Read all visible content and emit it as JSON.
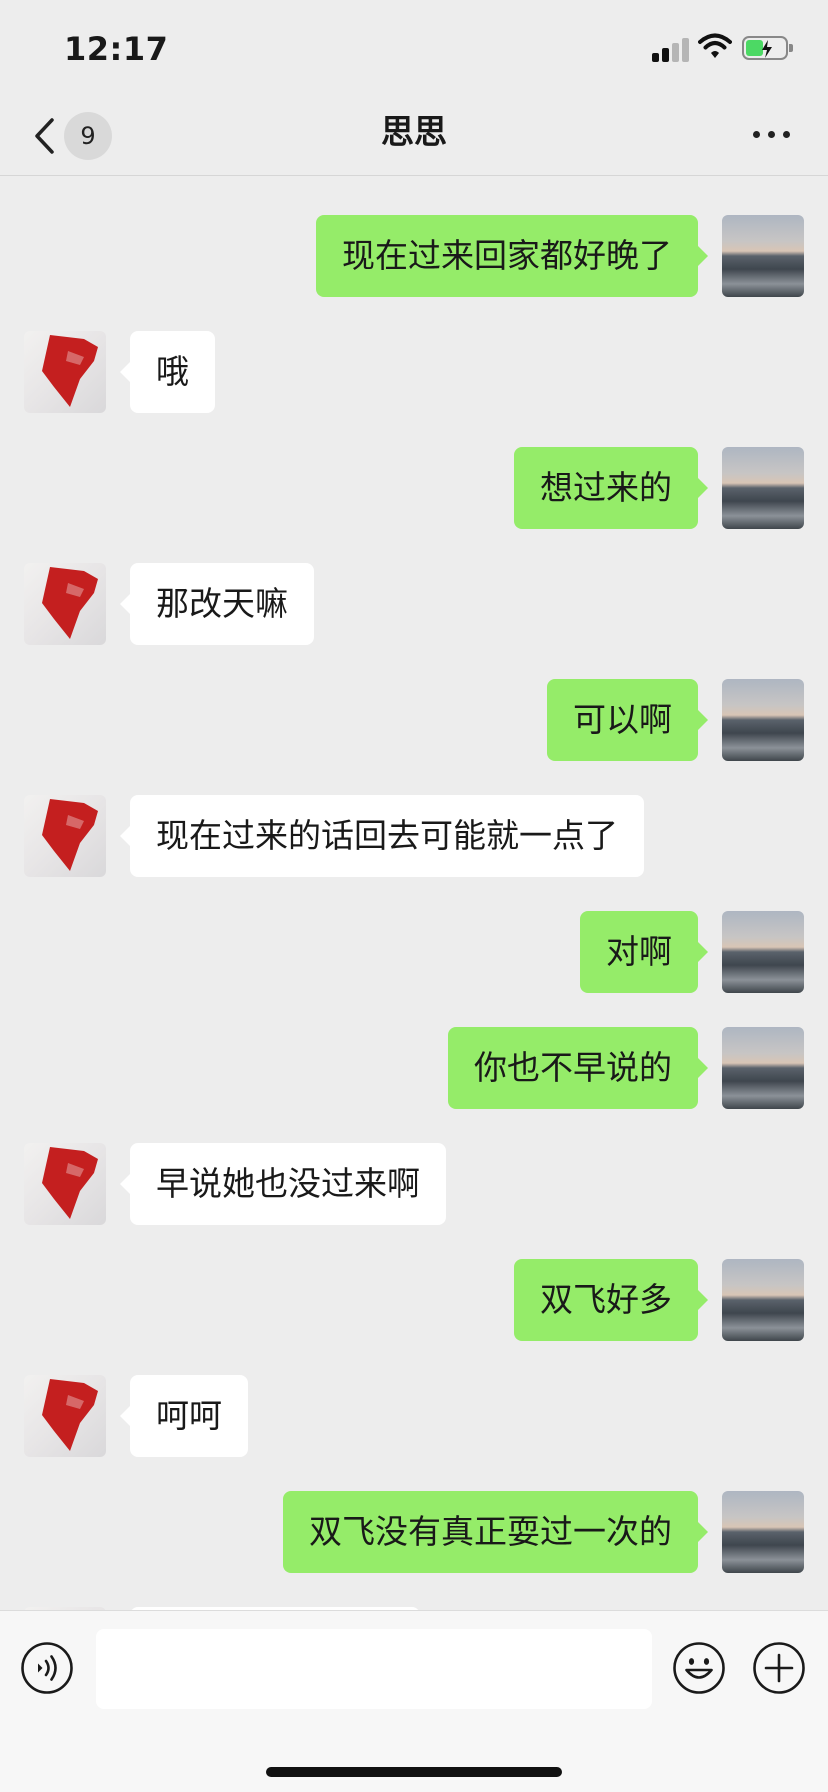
{
  "status_bar": {
    "time": "12:17"
  },
  "header": {
    "back_badge_count": "9",
    "title": "思思"
  },
  "messages": [
    {
      "from": "self",
      "text": "现在过来回家都好晚了"
    },
    {
      "from": "peer",
      "text": "哦"
    },
    {
      "from": "self",
      "text": "想过来的"
    },
    {
      "from": "peer",
      "text": "那改天嘛"
    },
    {
      "from": "self",
      "text": "可以啊"
    },
    {
      "from": "peer",
      "text": "现在过来的话回去可能就一点了"
    },
    {
      "from": "self",
      "text": "对啊"
    },
    {
      "from": "self",
      "text": "你也不早说的"
    },
    {
      "from": "peer",
      "text": "早说她也没过来啊"
    },
    {
      "from": "self",
      "text": "双飞好多"
    },
    {
      "from": "peer",
      "text": "呵呵"
    },
    {
      "from": "self",
      "text": "双飞没有真正耍过一次的"
    },
    {
      "from": "peer",
      "text": ""
    }
  ],
  "input_bar": {
    "message_value": ""
  },
  "icons": {
    "back": "chevron-left-icon",
    "more": "more-dots-icon",
    "voice": "voice-icon",
    "emoji": "emoji-icon",
    "plus": "plus-icon"
  },
  "colors": {
    "background": "#ededed",
    "self_bubble": "#95ec69",
    "peer_bubble": "#ffffff",
    "input_bar": "#f7f7f7"
  }
}
